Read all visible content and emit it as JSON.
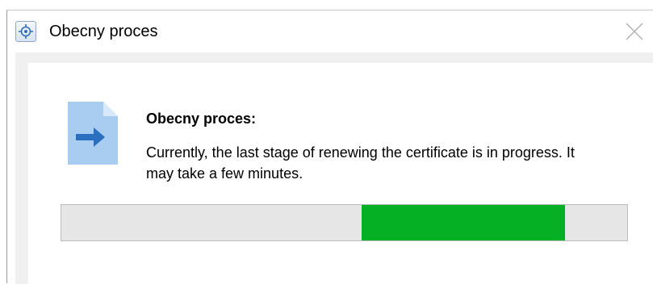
{
  "window": {
    "title": "Obecny proces",
    "app_icon": "process-app-icon",
    "close_icon": "close-icon"
  },
  "content": {
    "icon": "document-arrow-icon",
    "heading": "Obecny proces:",
    "message": "Currently, the last stage of renewing the certificate is in progress. It may take a few minutes."
  },
  "progress": {
    "mode": "marquee",
    "segment_start": 0.53,
    "segment_end": 0.89,
    "fill_color": "#06b025",
    "track_color": "#e6e6e6"
  }
}
